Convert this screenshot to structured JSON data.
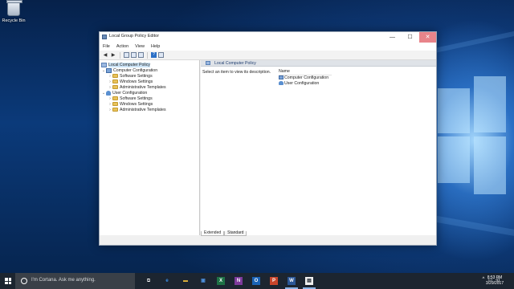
{
  "desktop": {
    "recycle_bin_label": "Recycle Bin"
  },
  "window": {
    "title": "Local Group Policy Editor",
    "minimize_glyph": "—",
    "maximize_glyph": "☐",
    "close_glyph": "✕",
    "menu": [
      "File",
      "Action",
      "View",
      "Help"
    ],
    "toolbar": {
      "back_glyph": "◀",
      "forward_glyph": "▶",
      "help_glyph": "?"
    },
    "tree": {
      "root": "Local Computer Policy",
      "computer_config": "Computer Configuration",
      "user_config": "User Configuration",
      "software_settings": "Software Settings",
      "windows_settings": "Windows Settings",
      "admin_templates": "Administrative Templates",
      "expanded_glyph": "⌄",
      "collapsed_glyph": "›"
    },
    "details": {
      "header_title": "Local Computer Policy",
      "description": "Select an item to view its description.",
      "column_name": "Name",
      "items": [
        "Computer Configuration",
        "User Configuration"
      ]
    },
    "tabs": [
      "Extended",
      "Standard"
    ]
  },
  "taskbar": {
    "search_placeholder": "I'm Cortana. Ask me anything.",
    "clock_time": "8:53 PM",
    "clock_date": "3/29/2017",
    "tray_up_glyph": "^",
    "tray_network_glyph": "▭",
    "tray_volume_glyph": "◃)",
    "task_icons": {
      "task_view": "⧉",
      "edge": "e",
      "explorer": "▬",
      "store": "▣",
      "excel": "X",
      "onenote": "N",
      "outlook": "O",
      "powerpoint": "P",
      "word": "W",
      "gpedit": "▤"
    },
    "colors": {
      "edge": "#3a8ee6",
      "explorer": "#e8b83a",
      "store": "#4d8fdc",
      "excel": "#1e7145",
      "onenote": "#7d3a9b",
      "outlook": "#1a63b6",
      "powerpoint": "#c8452b",
      "word": "#2b5797",
      "gpedit": "#f0f0f0"
    }
  }
}
